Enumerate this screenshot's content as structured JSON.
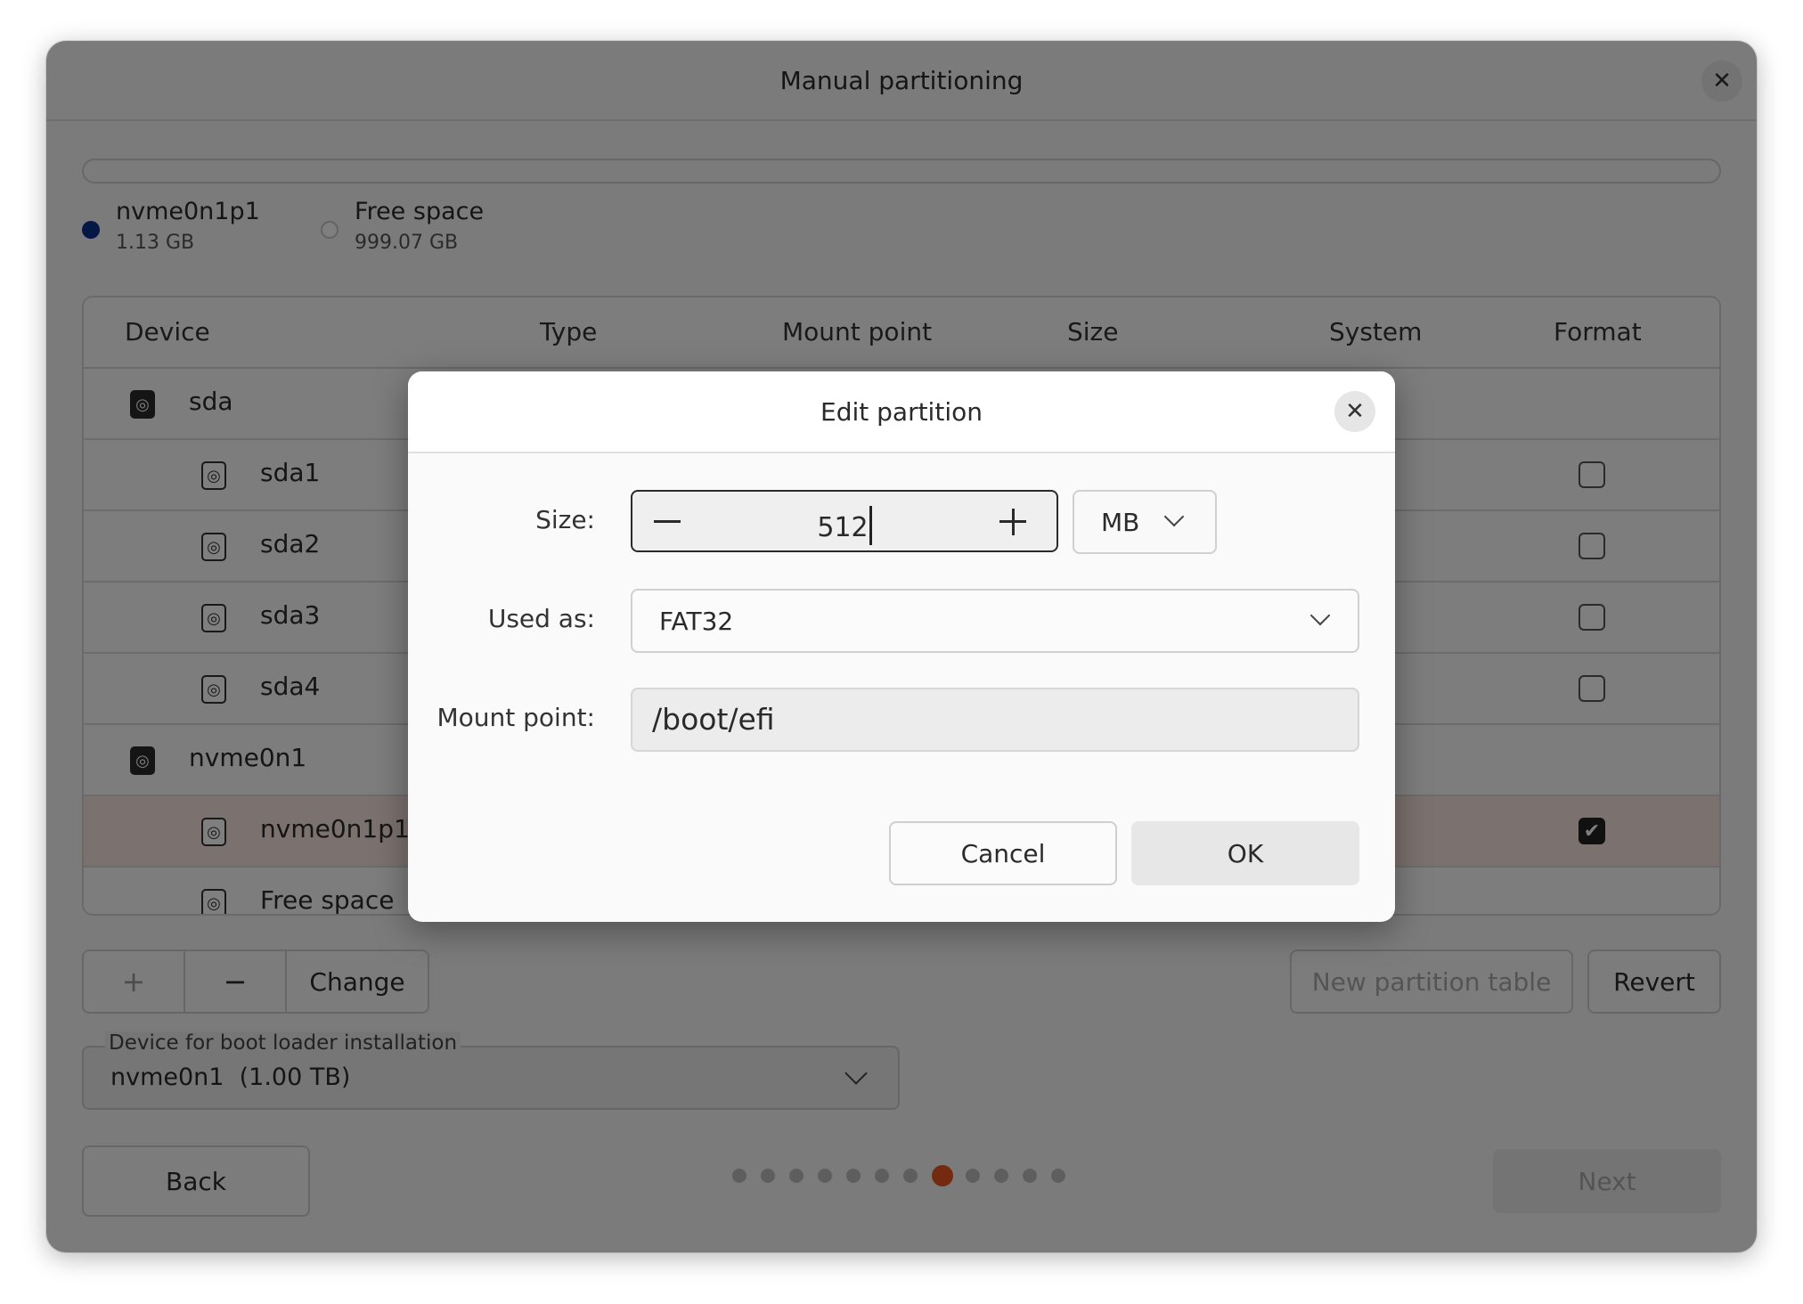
{
  "window": {
    "title": "Manual partitioning"
  },
  "legend": [
    {
      "name": "nvme0n1p1",
      "size": "1.13 GB",
      "color": "#0b2f8a"
    },
    {
      "name": "Free space",
      "size": "999.07 GB",
      "color": "#ffffff"
    }
  ],
  "table": {
    "headers": [
      "Device",
      "Type",
      "Mount point",
      "Size",
      "System",
      "Format"
    ],
    "rows": [
      {
        "name": "sda",
        "level": 0,
        "format": null
      },
      {
        "name": "sda1",
        "level": 1,
        "format": false
      },
      {
        "name": "sda2",
        "level": 1,
        "format": false
      },
      {
        "name": "sda3",
        "level": 1,
        "format": false
      },
      {
        "name": "sda4",
        "level": 1,
        "format": false
      },
      {
        "name": "nvme0n1",
        "level": 0,
        "format": null
      },
      {
        "name": "nvme0n1p1",
        "level": 1,
        "format": true,
        "selected": true
      },
      {
        "name": "Free space",
        "level": 1,
        "format": null
      }
    ]
  },
  "actions": {
    "add": "+",
    "remove": "−",
    "change": "Change",
    "new_table": "New partition table",
    "revert": "Revert"
  },
  "bootloader": {
    "label": "Device for boot loader installation",
    "value": "nvme0n1  (1.00 TB)"
  },
  "nav": {
    "back": "Back",
    "next": "Next",
    "pages": 12,
    "current": 7,
    "accent": "#e95420"
  },
  "dialog": {
    "title": "Edit partition",
    "size_label": "Size:",
    "size_value": "512",
    "unit": "MB",
    "used_as_label": "Used as:",
    "used_as_value": "FAT32",
    "mount_label": "Mount point:",
    "mount_value": "/boot/efi",
    "cancel": "Cancel",
    "ok": "OK"
  }
}
